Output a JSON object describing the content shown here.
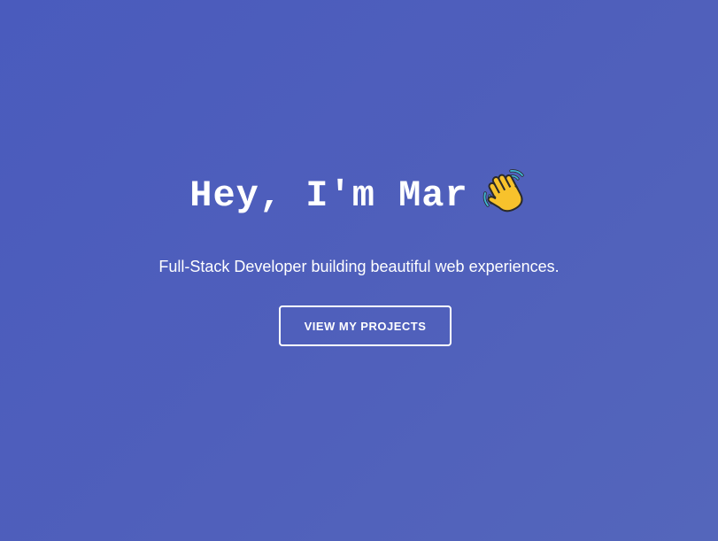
{
  "hero": {
    "title": "Hey, I'm Mar",
    "title_icon": "waving-hand-icon",
    "subtitle": "Full-Stack Developer building beautiful web experiences.",
    "cta_label": "VIEW MY PROJECTS"
  },
  "colors": {
    "background": "#4f5fbb",
    "text": "#ffffff",
    "button_border": "#ffffff"
  }
}
